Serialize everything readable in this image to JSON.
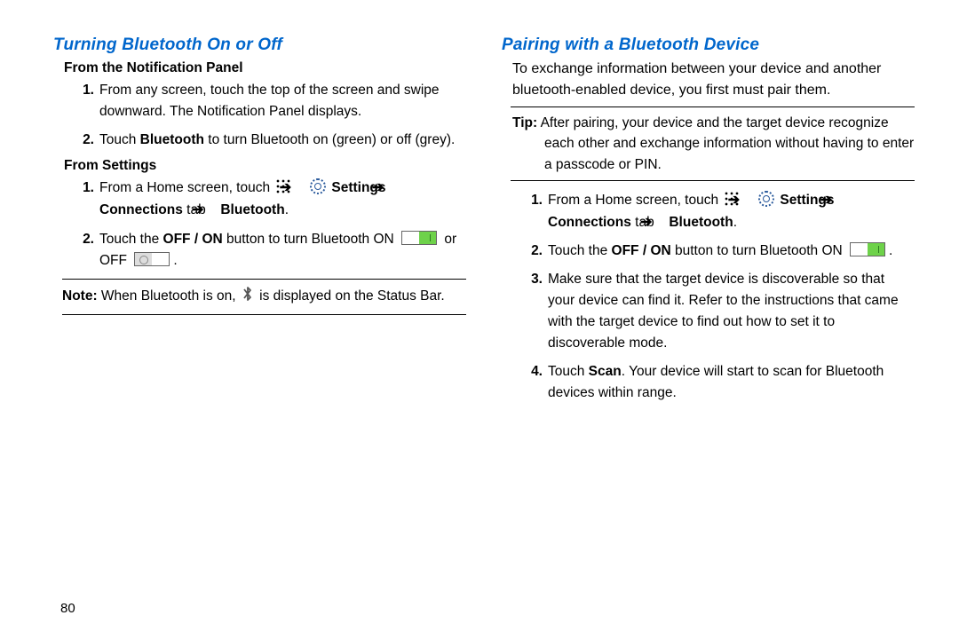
{
  "page_number": "80",
  "left": {
    "heading": "Turning Bluetooth On or Off",
    "sub1": "From the Notification Panel",
    "steps1": [
      "From any screen, touch the top of the screen and swipe downward. The Notification Panel displays.",
      [
        "Touch ",
        {
          "b": "Bluetooth"
        },
        " to turn Bluetooth on (green) or off (grey)."
      ]
    ],
    "sub2": "From Settings",
    "steps2": [
      [
        "From a Home screen, touch ",
        {
          "icon": "apps"
        },
        " ",
        {
          "icon": "arrow"
        },
        " ",
        {
          "icon": "settings"
        },
        " ",
        {
          "b": "Settings"
        },
        " ",
        {
          "icon": "arrow"
        },
        " ",
        {
          "b": "Connections"
        },
        " tab ",
        {
          "icon": "arrow"
        },
        " ",
        {
          "b": "Bluetooth"
        },
        "."
      ],
      [
        "Touch the ",
        {
          "b": "OFF / ON"
        },
        " button to turn Bluetooth ON ",
        {
          "icon": "toggle-on"
        },
        " or OFF ",
        {
          "icon": "toggle-off"
        },
        "."
      ]
    ],
    "note": [
      "",
      {
        "b": "Note:"
      },
      " When Bluetooth is on, ",
      {
        "icon": "bt"
      },
      " is displayed on the Status Bar."
    ]
  },
  "right": {
    "heading": "Pairing with a Bluetooth Device",
    "intro": "To exchange information between your device and another bluetooth-enabled device, you first must pair them.",
    "tip": [
      "",
      {
        "b": "Tip:"
      },
      " After pairing, your device and the target device recognize each other and exchange information without having to enter a passcode or PIN."
    ],
    "steps": [
      [
        "From a Home screen, touch ",
        {
          "icon": "apps"
        },
        " ",
        {
          "icon": "arrow"
        },
        " ",
        {
          "icon": "settings"
        },
        " ",
        {
          "b": "Settings"
        },
        " ",
        {
          "icon": "arrow"
        },
        " ",
        {
          "b": "Connections"
        },
        " tab ",
        {
          "icon": "arrow"
        },
        " ",
        {
          "b": "Bluetooth"
        },
        "."
      ],
      [
        "Touch the ",
        {
          "b": "OFF / ON"
        },
        " button to turn Bluetooth ON ",
        {
          "icon": "toggle-on"
        },
        "."
      ],
      "Make sure that the target device is discoverable so that your device can find it. Refer to the instructions that came with the target device to find out how to set it to discoverable mode.",
      [
        "Touch ",
        {
          "b": "Scan"
        },
        ". Your device will start to scan for Bluetooth devices within range."
      ]
    ]
  }
}
